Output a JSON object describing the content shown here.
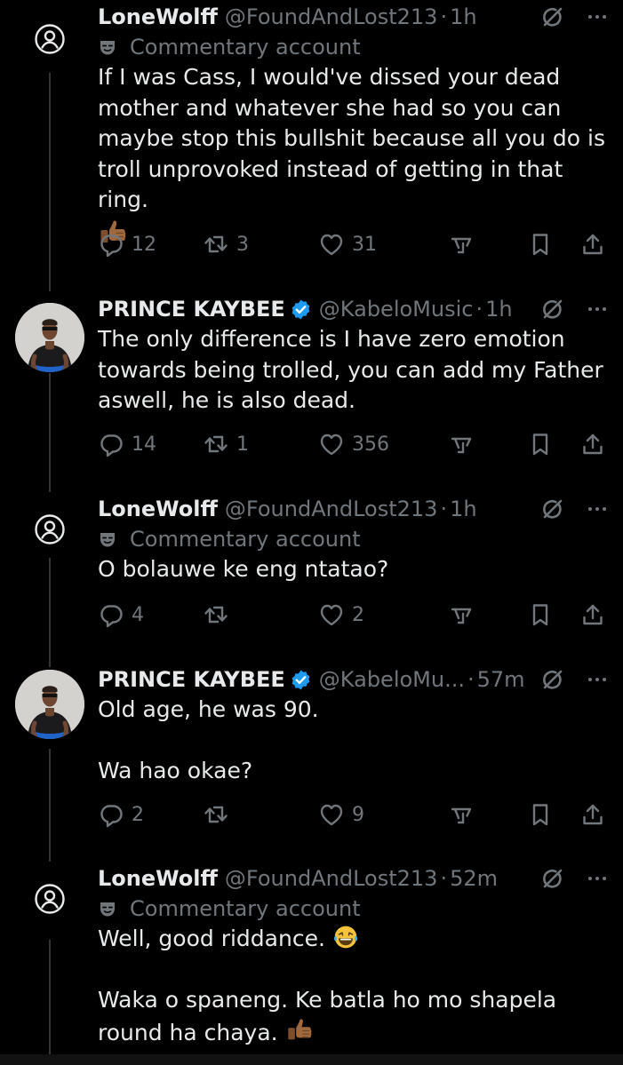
{
  "tweets": [
    {
      "name": "LoneWolff",
      "handle": "@FoundAndLost213",
      "sep": "·",
      "time": "1h",
      "label": "Commentary account",
      "text": "If I was Cass, I would've dissed your dead\nmother and whatever she had so you can\nmaybe stop this bullshit because all you do is\ntroll unprovoked instead of getting in that ring.",
      "replies": "12",
      "reposts": "3",
      "likes": "31"
    },
    {
      "name": "PRINCE KAYBEE",
      "handle": "@KabeloMusic",
      "sep": "·",
      "time": "1h",
      "text": "The only difference is I have zero emotion\ntowards being trolled, you can add my Father\naswell, he is also dead.",
      "replies": "14",
      "reposts": "1",
      "likes": "356"
    },
    {
      "name": "LoneWolff",
      "handle": "@FoundAndLost213",
      "sep": "·",
      "time": "1h",
      "label": "Commentary account",
      "text": "O bolauwe ke eng ntatao?",
      "replies": "4",
      "reposts": "",
      "likes": "2"
    },
    {
      "name": "PRINCE KAYBEE",
      "handle": "@KabeloMu...",
      "sep": "·",
      "time": "57m",
      "text": "Old age, he was 90.\n\nWa hao okae?",
      "replies": "2",
      "reposts": "",
      "likes": "9"
    },
    {
      "name": "LoneWolff",
      "handle": "@FoundAndLost213",
      "sep": "·",
      "time": "52m",
      "label": "Commentary account",
      "text_1": "Well, good riddance.",
      "text_2": "Waka o spaneng. Ke batla ho mo shapela\nround ha chaya."
    }
  ],
  "colors": {
    "background": "#000000",
    "text": "#e7e9ea",
    "muted": "#71767b",
    "verified": "#1d9bf0",
    "thread_line": "#333639"
  },
  "icons": {
    "default_avatar": "person-circle-icon",
    "verified": "verified-badge-icon",
    "grok": "grok-icon",
    "more": "more-icon",
    "label": "theater-mask-icon",
    "reply": "reply-icon",
    "repost": "repost-icon",
    "like": "heart-icon",
    "views": "analytics-icon",
    "bookmark": "bookmark-icon",
    "share": "share-icon",
    "emoji_thumbs": "thumbs-up-emoji",
    "emoji_laugh": "laughing-tears-emoji"
  }
}
